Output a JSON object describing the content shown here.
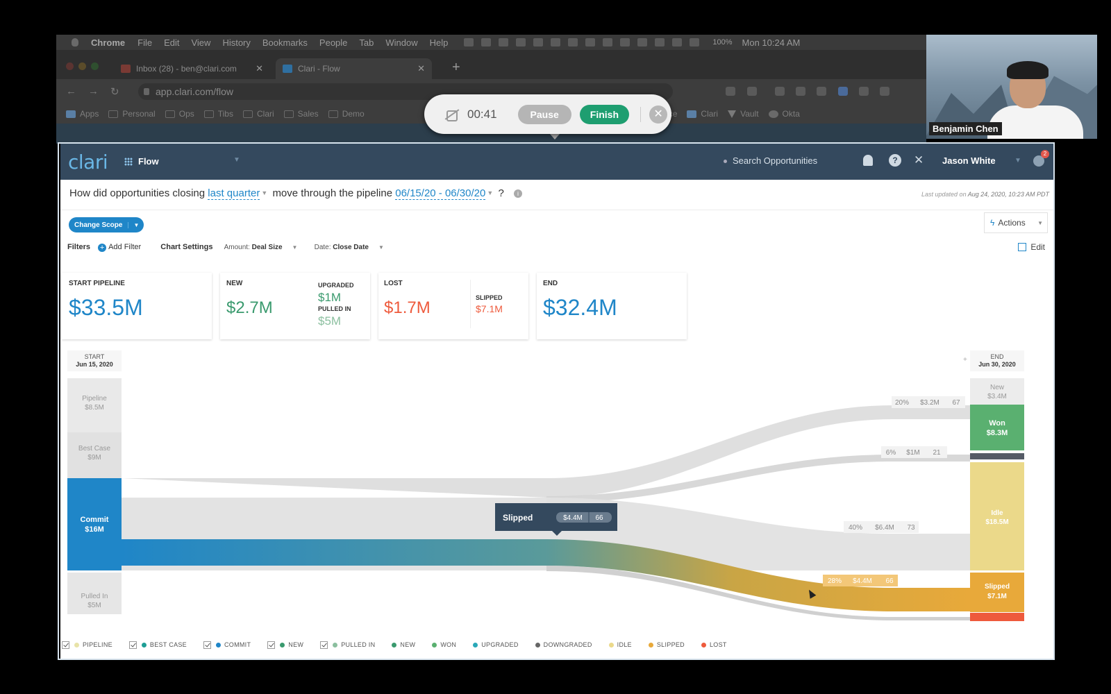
{
  "menubar": {
    "app": "Chrome",
    "items": [
      "File",
      "Edit",
      "View",
      "History",
      "Bookmarks",
      "People",
      "Tab",
      "Window",
      "Help"
    ],
    "battery": "100%",
    "clock": "Mon 10:24 AM"
  },
  "browser": {
    "tabs": [
      {
        "label": "Inbox (28) - ben@clari.com",
        "icon": "gmail-icon"
      },
      {
        "label": "Clari - Flow",
        "icon": "clari-icon"
      }
    ],
    "url": "app.clari.com/flow",
    "bookmarks": [
      "Apps",
      "Personal",
      "Ops",
      "Tibs",
      "Clari",
      "Sales",
      "Demo"
    ],
    "bookmarks_right": [
      "Salesforce",
      "Clari",
      "Vault",
      "Okta"
    ]
  },
  "recorder": {
    "timer": "00:41",
    "pause_label": "Pause",
    "finish_label": "Finish",
    "close_glyph": "✕"
  },
  "webcam": {
    "name": "Benjamin Chen"
  },
  "header": {
    "logo": "clari",
    "module": "Flow",
    "search_placeholder": "Search Opportunities",
    "user": "Jason White",
    "notification_count": "2"
  },
  "question": {
    "part1": "How did opportunities closing",
    "scope": "last quarter",
    "part2": "move through the pipeline",
    "range": "06/15/20 - 06/30/20",
    "part3": "?",
    "last_updated_prefix": "Last updated on",
    "last_updated": "Aug 24, 2020, 10:23 AM PDT"
  },
  "toolbar": {
    "change_scope": "Change Scope",
    "actions": "Actions",
    "filters_label": "Filters",
    "add_filter": "Add Filter",
    "chart_settings": "Chart Settings",
    "amount_prefix": "Amount:",
    "amount_value": "Deal Size",
    "date_prefix": "Date:",
    "date_value": "Close Date",
    "edit": "Edit"
  },
  "metrics": {
    "start": {
      "label": "START PIPELINE",
      "value": "$33.5M"
    },
    "new": {
      "label": "NEW",
      "value": "$2.7M",
      "upgraded_label": "UPGRADED",
      "upgraded_value": "$1M",
      "pulled_in_label": "PULLED IN",
      "pulled_in_value": "$5M"
    },
    "lost": {
      "label": "LOST",
      "value": "$1.7M",
      "slipped_label": "SLIPPED",
      "slipped_value": "$7.1M"
    },
    "end": {
      "label": "END",
      "value": "$32.4M"
    }
  },
  "flow": {
    "start": {
      "title": "START",
      "date": "Jun 15, 2020"
    },
    "end": {
      "title": "END",
      "date": "Jun 30, 2020"
    },
    "left_nodes": [
      {
        "name": "Pipeline",
        "value": "$8.5M"
      },
      {
        "name": "Best Case",
        "value": "$9M"
      },
      {
        "name": "Commit",
        "value": "$16M"
      },
      {
        "name": "Pulled In",
        "value": "$5M"
      }
    ],
    "right_nodes": [
      {
        "name": "New",
        "value": "$3.4M"
      },
      {
        "name": "Won",
        "value": "$8.3M"
      },
      {
        "name": "Idle",
        "value": "$18.5M"
      },
      {
        "name": "Slipped",
        "value": "$7.1M"
      }
    ],
    "flow_labels": [
      {
        "pct": "20%",
        "amount": "$3.2M",
        "count": "67"
      },
      {
        "pct": "6%",
        "amount": "$1M",
        "count": "21"
      },
      {
        "pct": "40%",
        "amount": "$6.4M",
        "count": "73"
      },
      {
        "pct": "28%",
        "amount": "$4.4M",
        "count": "66"
      }
    ],
    "tooltip": {
      "title": "Slipped",
      "amount": "$4.4M",
      "count": "66"
    }
  },
  "colors": {
    "pipeline": "#e8e3a8",
    "best_case": "#1e9e95",
    "commit": "#1f86c8",
    "new": "#3a9a6e",
    "pulled_in": "#8bbf9f",
    "won": "#5ab070",
    "upgraded": "#2aa8b8",
    "downgraded": "#666666",
    "idle": "#ebd98a",
    "slipped": "#e8a93a",
    "lost": "#ee5a3c"
  },
  "legend": [
    {
      "label": "PIPELINE",
      "color": "#e8e3a8",
      "checkbox": true
    },
    {
      "label": "BEST CASE",
      "color": "#1e9e95",
      "checkbox": true
    },
    {
      "label": "COMMIT",
      "color": "#1f86c8",
      "checkbox": true
    },
    {
      "label": "NEW",
      "color": "#3a9a6e",
      "checkbox": true
    },
    {
      "label": "PULLED IN",
      "color": "#8bbf9f",
      "checkbox": true
    },
    {
      "label": "NEW",
      "color": "#3a9a6e",
      "checkbox": false
    },
    {
      "label": "WON",
      "color": "#5ab070",
      "checkbox": false
    },
    {
      "label": "UPGRADED",
      "color": "#2aa8b8",
      "checkbox": false
    },
    {
      "label": "DOWNGRADED",
      "color": "#666666",
      "checkbox": false
    },
    {
      "label": "IDLE",
      "color": "#ebd98a",
      "checkbox": false
    },
    {
      "label": "SLIPPED",
      "color": "#e8a93a",
      "checkbox": false
    },
    {
      "label": "LOST",
      "color": "#ee5a3c",
      "checkbox": false
    }
  ]
}
